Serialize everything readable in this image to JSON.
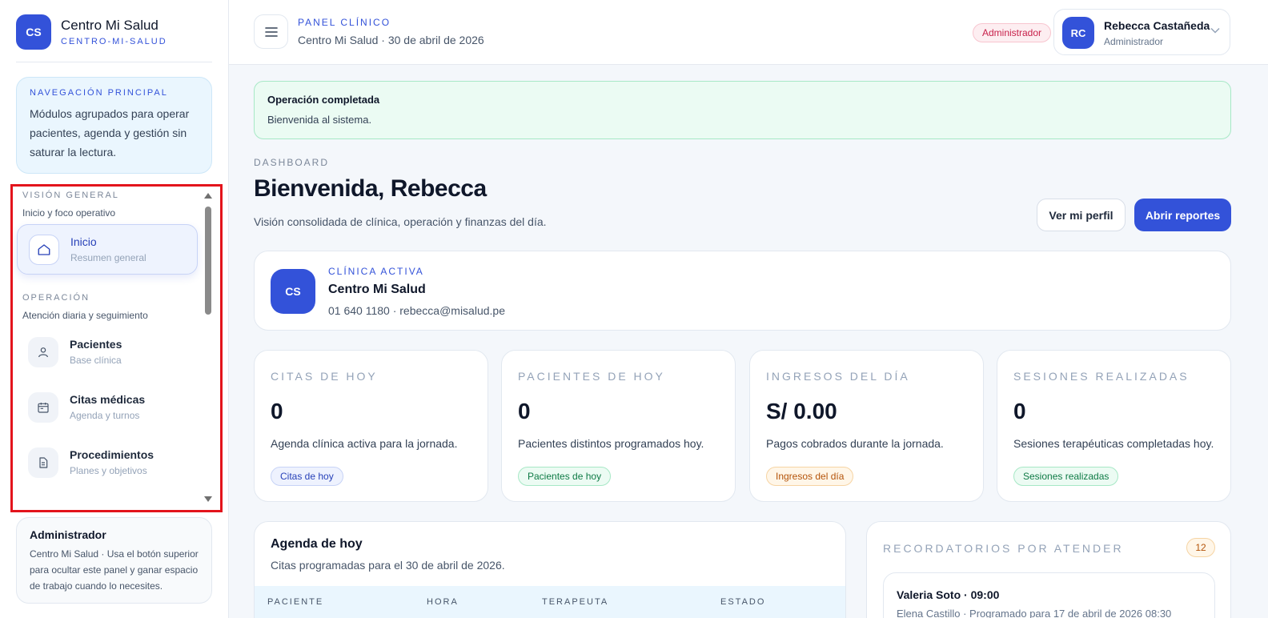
{
  "brand": {
    "initials": "CS",
    "name": "Centro Mi Salud",
    "slug": "CENTRO-MI-SALUD"
  },
  "nav_card": {
    "title": "NAVEGACIÓN PRINCIPAL",
    "text": "Módulos agrupados para operar pacientes, agenda y gestión sin saturar la lectura."
  },
  "nav": {
    "sections": [
      {
        "title": "VISIÓN GENERAL",
        "subtitle": "Inicio y foco operativo"
      },
      {
        "title": "OPERACIÓN",
        "subtitle": "Atención diaria y seguimiento"
      }
    ],
    "items": [
      {
        "label": "Inicio",
        "sub": "Resumen general",
        "icon": "home-icon",
        "active": true
      },
      {
        "label": "Pacientes",
        "sub": "Base clínica",
        "icon": "user-icon"
      },
      {
        "label": "Citas médicas",
        "sub": "Agenda y turnos",
        "icon": "calendar-icon"
      },
      {
        "label": "Procedimientos",
        "sub": "Planes y objetivos",
        "icon": "document-icon"
      }
    ]
  },
  "admin_card": {
    "title": "Administrador",
    "text": "Centro Mi Salud · Usa el botón superior para ocultar este panel y ganar espacio de trabajo cuando lo necesites."
  },
  "header": {
    "eyebrow": "PANEL CLÍNICO",
    "title": "Centro Mi Salud · 30 de abril de 2026",
    "role_badge": "Administrador",
    "user": {
      "initials": "RC",
      "name": "Rebecca Castañeda",
      "role": "Administrador"
    }
  },
  "alert": {
    "title": "Operación completada",
    "text": "Bienvenida al sistema."
  },
  "dashboard": {
    "eyebrow": "DASHBOARD",
    "title": "Bienvenida, Rebecca",
    "subtitle": "Visión consolidada de clínica, operación y finanzas del día.",
    "btn_profile": "Ver mi perfil",
    "btn_reports": "Abrir reportes"
  },
  "clinic": {
    "initials": "CS",
    "eyebrow": "CLÍNICA ACTIVA",
    "name": "Centro Mi Salud",
    "contact": "01 640 1180 · rebecca@misalud.pe"
  },
  "stats": [
    {
      "label": "CITAS DE HOY",
      "value": "0",
      "desc": "Agenda clínica activa para la jornada.",
      "chip": "Citas de hoy"
    },
    {
      "label": "PACIENTES DE HOY",
      "value": "0",
      "desc": "Pacientes distintos programados hoy.",
      "chip": "Pacientes de hoy"
    },
    {
      "label": "INGRESOS DEL DÍA",
      "value": "S/ 0.00",
      "desc": "Pagos cobrados durante la jornada.",
      "chip": "Ingresos del día"
    },
    {
      "label": "SESIONES REALIZADAS",
      "value": "0",
      "desc": "Sesiones terapéuticas completadas hoy.",
      "chip": "Sesiones realizadas"
    }
  ],
  "agenda": {
    "title": "Agenda de hoy",
    "subtitle": "Citas programadas para el 30 de abril de 2026.",
    "columns": [
      "PACIENTE",
      "HORA",
      "TERAPEUTA",
      "ESTADO"
    ]
  },
  "reminders": {
    "title": "RECORDATORIOS POR ATENDER",
    "count": "12",
    "items": [
      {
        "title": "Valeria Soto · 09:00",
        "text": "Elena Castillo · Programado para 17 de abril de 2026 08:30"
      }
    ]
  },
  "colors": {
    "accent": "#3352d9",
    "success_bg": "#ebfbf3",
    "highlight_border": "#e3141c"
  }
}
